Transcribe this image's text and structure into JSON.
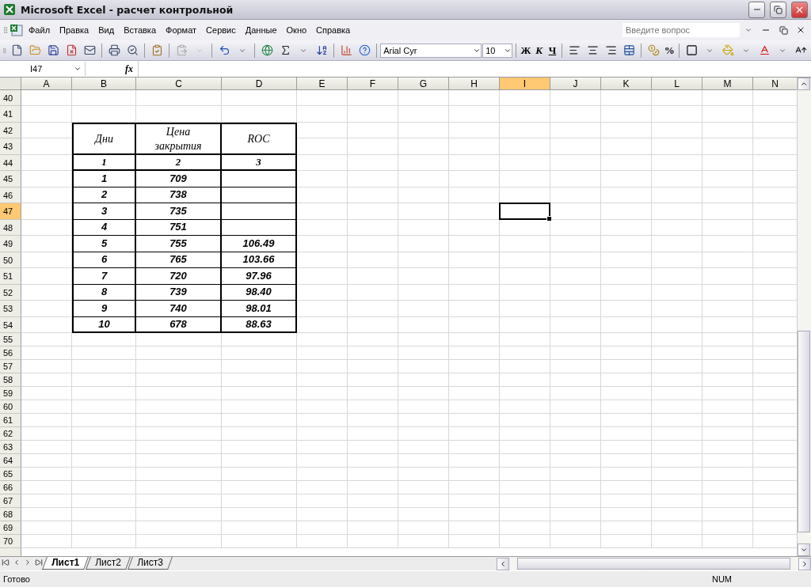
{
  "window": {
    "title": "Microsoft Excel - расчет контрольной"
  },
  "menu": [
    "Файл",
    "Правка",
    "Вид",
    "Вставка",
    "Формат",
    "Сервис",
    "Данные",
    "Окно",
    "Справка"
  ],
  "help_search": {
    "placeholder": "Введите вопрос"
  },
  "toolbar": {
    "font": "Arial Cyr",
    "size": "10",
    "bold": "Ж",
    "italic": "К",
    "underline": "Ч",
    "percent": "%"
  },
  "formula_bar": {
    "name_box": "I47",
    "fx": "fx"
  },
  "columns": [
    {
      "label": "A",
      "selected": false
    },
    {
      "label": "B",
      "selected": false
    },
    {
      "label": "C",
      "selected": false
    },
    {
      "label": "D",
      "selected": false
    },
    {
      "label": "E",
      "selected": false
    },
    {
      "label": "F",
      "selected": false
    },
    {
      "label": "G",
      "selected": false
    },
    {
      "label": "H",
      "selected": false
    },
    {
      "label": "I",
      "selected": true
    },
    {
      "label": "J",
      "selected": false
    },
    {
      "label": "K",
      "selected": false
    },
    {
      "label": "L",
      "selected": false
    },
    {
      "label": "M",
      "selected": false
    },
    {
      "label": "N",
      "selected": false
    }
  ],
  "rows": [
    {
      "label": "40",
      "selected": false
    },
    {
      "label": "41",
      "selected": false
    },
    {
      "label": "42",
      "selected": false
    },
    {
      "label": "43",
      "selected": false
    },
    {
      "label": "44",
      "selected": false
    },
    {
      "label": "45",
      "selected": false
    },
    {
      "label": "46",
      "selected": false
    },
    {
      "label": "47",
      "selected": true
    },
    {
      "label": "48",
      "selected": false
    },
    {
      "label": "49",
      "selected": false
    },
    {
      "label": "50",
      "selected": false
    },
    {
      "label": "51",
      "selected": false
    },
    {
      "label": "52",
      "selected": false
    },
    {
      "label": "53",
      "selected": false
    },
    {
      "label": "54",
      "selected": false
    },
    {
      "label": "55",
      "selected": false
    },
    {
      "label": "56",
      "selected": false
    },
    {
      "label": "57",
      "selected": false
    },
    {
      "label": "58",
      "selected": false
    },
    {
      "label": "59",
      "selected": false
    },
    {
      "label": "60",
      "selected": false
    },
    {
      "label": "61",
      "selected": false
    },
    {
      "label": "62",
      "selected": false
    },
    {
      "label": "63",
      "selected": false
    },
    {
      "label": "64",
      "selected": false
    },
    {
      "label": "65",
      "selected": false
    },
    {
      "label": "66",
      "selected": false
    },
    {
      "label": "67",
      "selected": false
    },
    {
      "label": "68",
      "selected": false
    },
    {
      "label": "69",
      "selected": false
    },
    {
      "label": "70",
      "selected": false
    }
  ],
  "table": {
    "headers": [
      "Дни",
      "Цена закрытия",
      "ROC"
    ],
    "numbers": [
      "1",
      "2",
      "3"
    ],
    "data": [
      {
        "day": "1",
        "close": "709"
      },
      {
        "day": "2",
        "close": "738"
      },
      {
        "day": "3",
        "close": "735"
      },
      {
        "day": "4",
        "close": "751"
      },
      {
        "day": "5",
        "close": "755",
        "roc": "106.49"
      },
      {
        "day": "6",
        "close": "765",
        "roc": "103.66"
      },
      {
        "day": "7",
        "close": "720",
        "roc": "97.96"
      },
      {
        "day": "8",
        "close": "739",
        "roc": "98.40"
      },
      {
        "day": "9",
        "close": "740",
        "roc": "98.01"
      },
      {
        "day": "10",
        "close": "678",
        "roc": "88.63"
      }
    ]
  },
  "sheet_tabs": [
    {
      "label": "Лист1",
      "selected": true
    },
    {
      "label": "Лист2",
      "selected": false
    },
    {
      "label": "Лист3",
      "selected": false
    }
  ],
  "status_bar": {
    "text": "Готово",
    "num": "NUM"
  }
}
